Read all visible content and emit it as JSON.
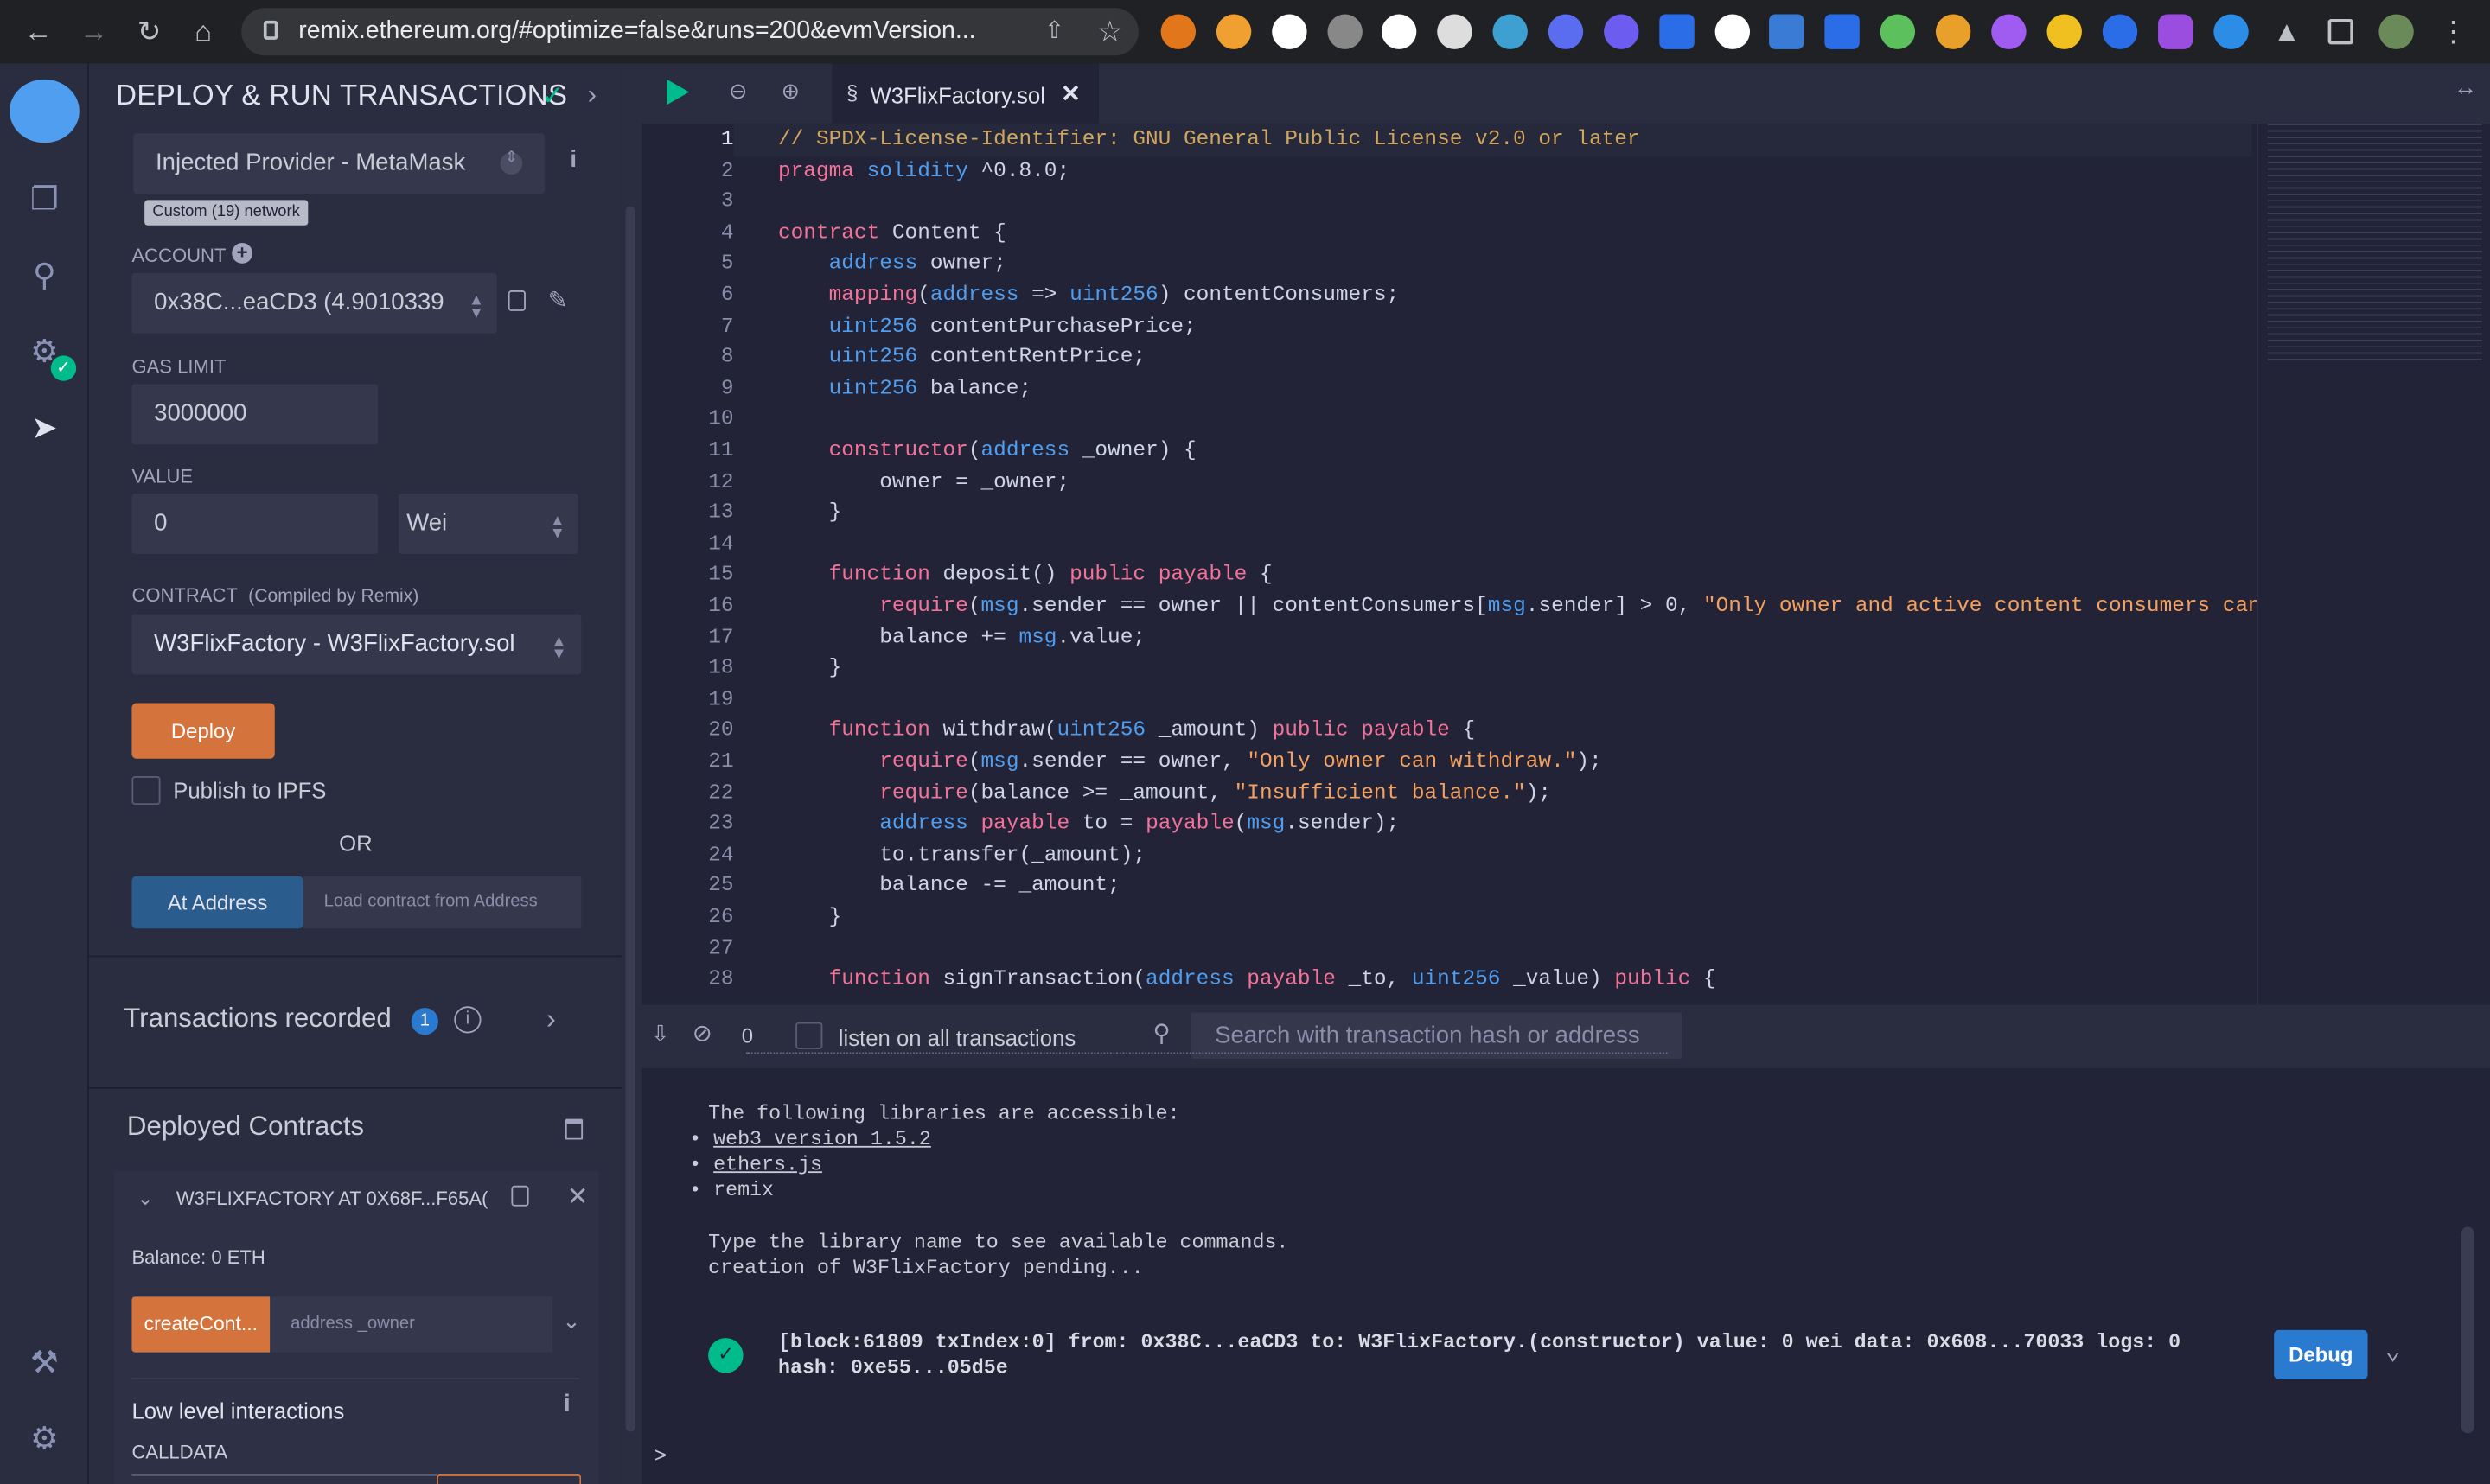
{
  "browser": {
    "url": "remix.ethereum.org/#optimize=false&runs=200&evmVersion..."
  },
  "panel": {
    "title": "DEPLOY & RUN TRANSACTIONS",
    "environment": "Injected Provider - MetaMask",
    "network_badge": "Custom (19) network",
    "account_label": "ACCOUNT",
    "account_value": "0x38C...eaCD3 (4.9010339",
    "gas_limit_label": "GAS LIMIT",
    "gas_limit_value": "3000000",
    "value_label": "VALUE",
    "value_amount": "0",
    "value_unit": "Wei",
    "contract_label": "CONTRACT",
    "contract_sublabel": "(Compiled by Remix)",
    "contract_value": "W3FlixFactory - W3FlixFactory.sol",
    "deploy_label": "Deploy",
    "publish_ipfs_label": "Publish to IPFS",
    "or_label": "OR",
    "at_address_label": "At Address",
    "load_contract_placeholder": "Load contract from Address",
    "transactions_recorded_label": "Transactions recorded",
    "transactions_recorded_count": "1",
    "deployed_contracts_label": "Deployed Contracts",
    "deployed_instance": "W3FLIXFACTORY AT 0X68F...F65A(",
    "balance": "Balance: 0 ETH",
    "create_fn_label": "createCont...",
    "create_fn_placeholder": "address _owner",
    "low_level_label": "Low level interactions",
    "calldata_label": "CALLDATA"
  },
  "editor": {
    "tab_name": "W3FlixFactory.sol",
    "line_numbers": [
      "1",
      "2",
      "3",
      "4",
      "5",
      "6",
      "7",
      "8",
      "9",
      "10",
      "11",
      "12",
      "13",
      "14",
      "15",
      "16",
      "17",
      "18",
      "19",
      "20",
      "21",
      "22",
      "23",
      "24",
      "25",
      "26",
      "27",
      "28"
    ]
  },
  "terminal": {
    "count": "0",
    "listen_label": "listen on all transactions",
    "search_placeholder": "Search with transaction hash or address",
    "line_libs": "The following libraries are accessible:",
    "lib_web3": "web3 version 1.5.2",
    "lib_ethers": "ethers.js",
    "lib_remix": "remix",
    "line_type": "Type the library name to see available commands.",
    "line_pending": "creation of W3FlixFactory pending...",
    "tx_line1": "[block:61809 txIndex:0] from: 0x38C...eaCD3 to: W3FlixFactory.(constructor) value: 0 wei data: 0x608...70033 logs: 0",
    "tx_line2": "hash: 0xe55...05d5e",
    "debug_label": "Debug",
    "prompt": ">"
  },
  "colors": {
    "accent_orange": "#d4733c",
    "accent_blue": "#2a5d8e",
    "success_green": "#00bc8c",
    "bg_panel": "#2a2c3f",
    "bg_editor": "#222336"
  }
}
